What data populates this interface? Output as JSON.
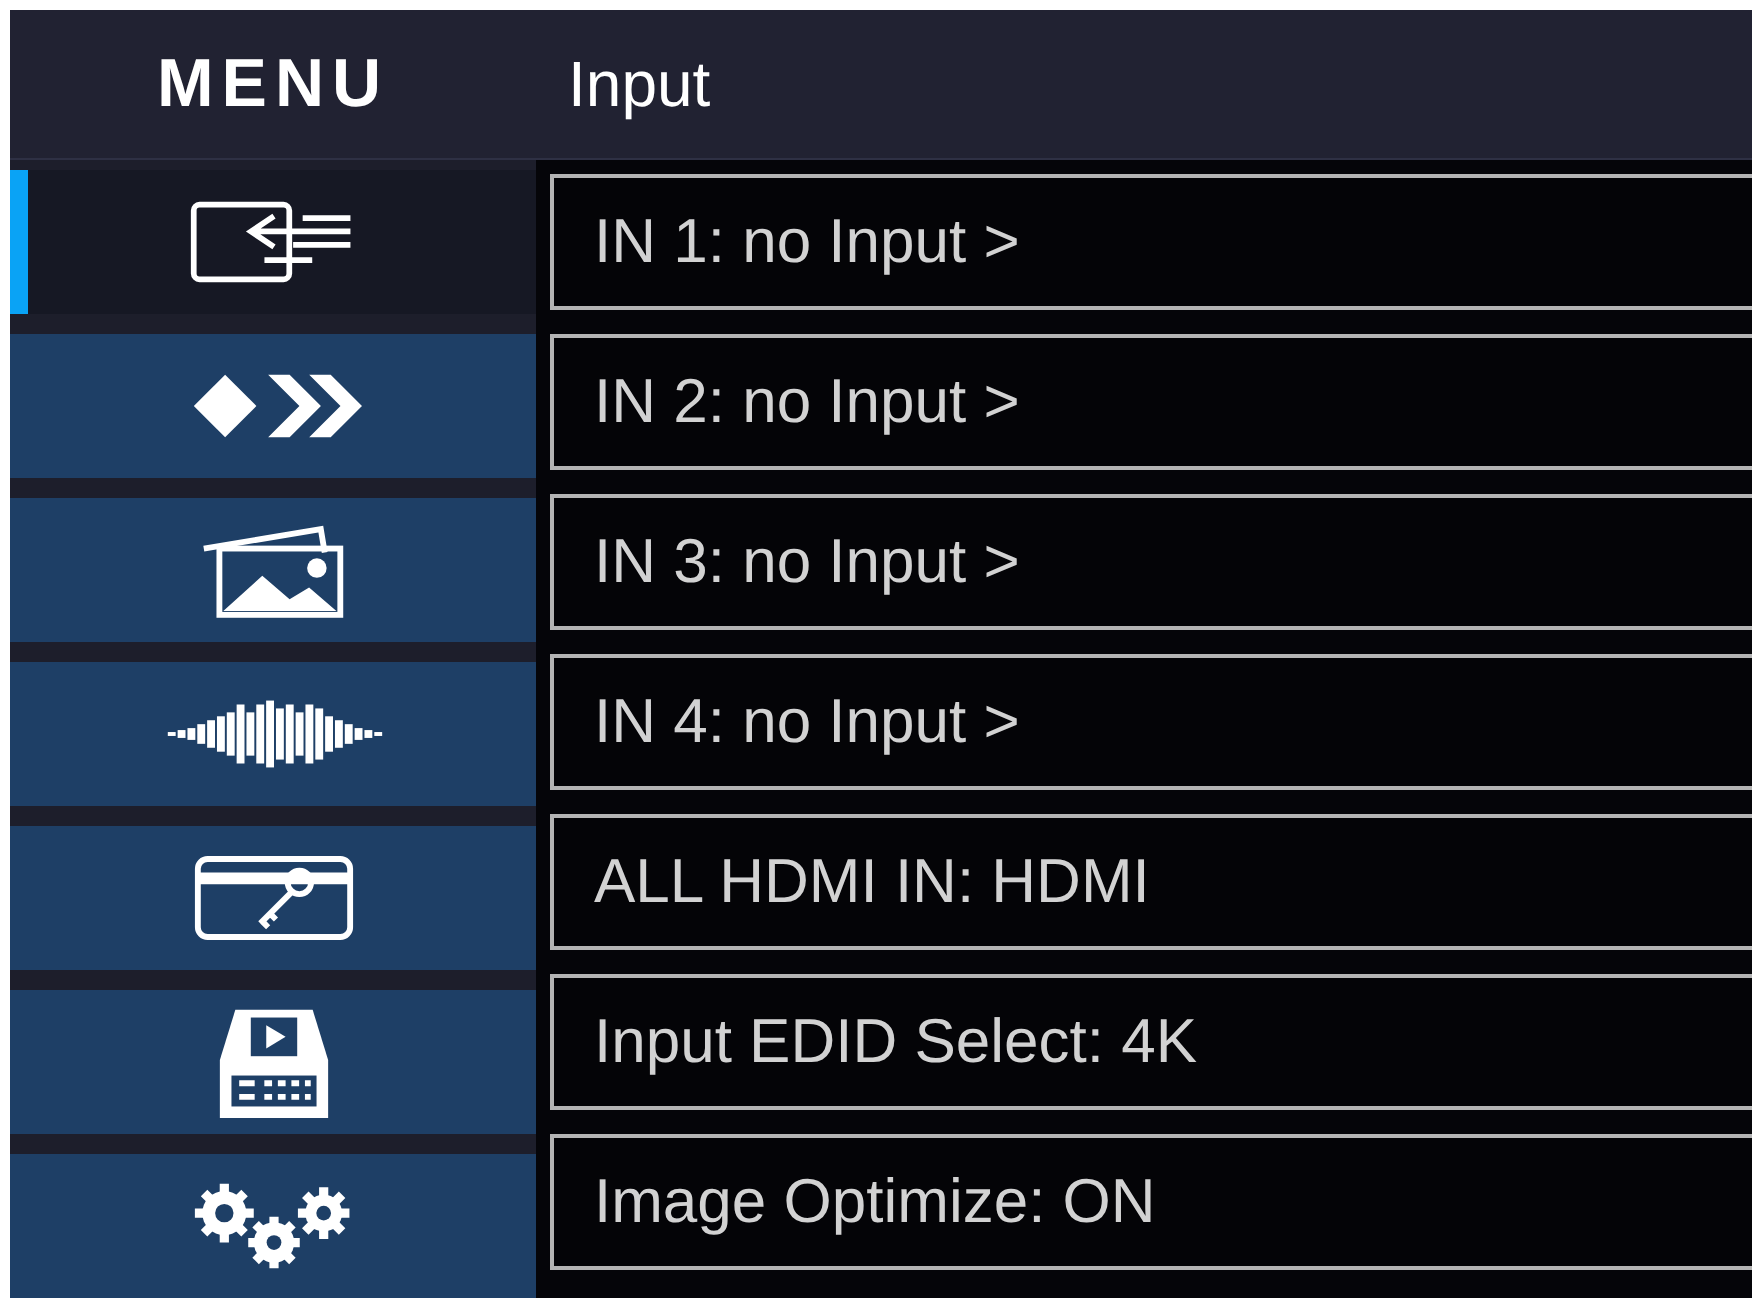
{
  "header": {
    "menu_label": "MENU",
    "title": "Input"
  },
  "sidebar": {
    "items": [
      {
        "kind": "input",
        "selected": true
      },
      {
        "kind": "transition",
        "selected": false
      },
      {
        "kind": "image",
        "selected": false
      },
      {
        "kind": "audio",
        "selected": false
      },
      {
        "kind": "key",
        "selected": false
      },
      {
        "kind": "device",
        "selected": false
      },
      {
        "kind": "settings",
        "selected": false
      }
    ]
  },
  "rows": [
    {
      "label": "IN 1: no Input >"
    },
    {
      "label": "IN 2: no Input >"
    },
    {
      "label": "IN 3: no Input >"
    },
    {
      "label": "IN 4: no Input >"
    },
    {
      "label": "ALL HDMI IN: HDMI"
    },
    {
      "label": "Input EDID Select: 4K"
    },
    {
      "label": "Image Optimize: ON"
    }
  ]
}
